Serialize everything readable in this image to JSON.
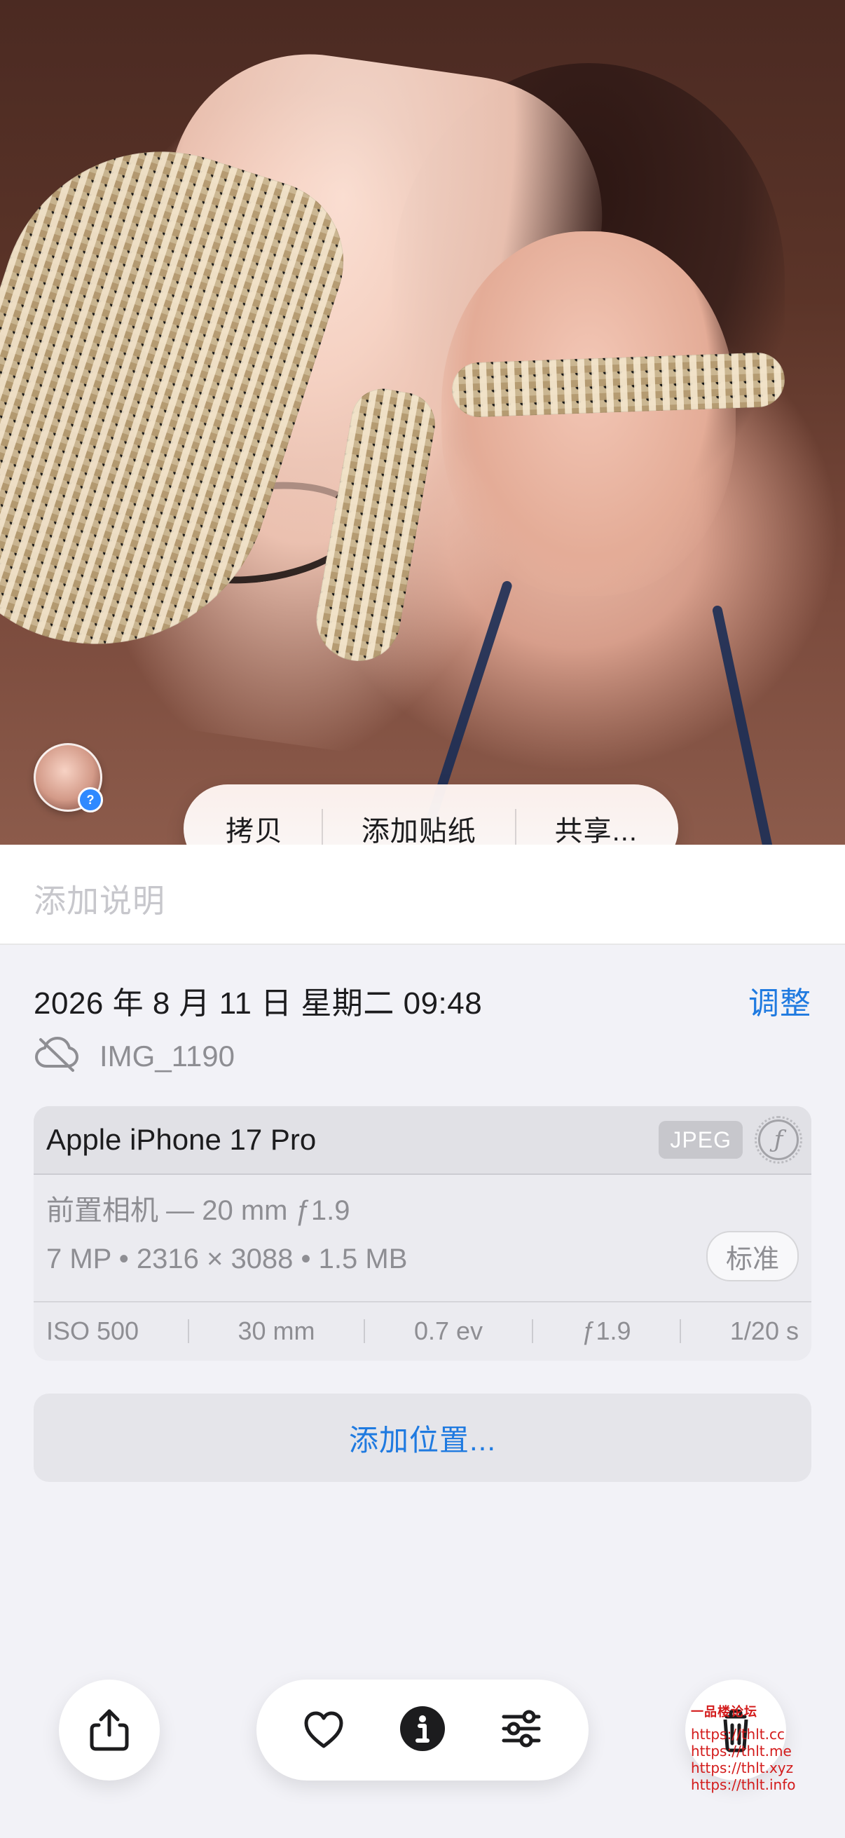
{
  "context_menu": {
    "items": [
      {
        "label": "拷贝"
      },
      {
        "label": "添加贴纸"
      },
      {
        "label": "共享..."
      }
    ]
  },
  "caption": {
    "placeholder": "添加说明"
  },
  "info": {
    "datetime": "2026 年 8 月 11 日 星期二 09:48",
    "adjust_label": "调整",
    "filename": "IMG_1190"
  },
  "camera_card": {
    "device": "Apple iPhone 17 Pro",
    "format_badge": "JPEG",
    "lens": "前置相机 — 20 mm ƒ1.9",
    "specs": "7 MP • 2316 × 3088 • 1.5 MB",
    "quality": "标准",
    "exif": {
      "iso": "ISO 500",
      "focal": "30 mm",
      "ev": "0.7 ev",
      "aperture": "ƒ1.9",
      "shutter": "1/20 s"
    }
  },
  "location": {
    "add_label": "添加位置..."
  },
  "watermark": {
    "title": "一品楼论坛",
    "lines": [
      "https://thlt.cc",
      "https://thlt.me",
      "https://thlt.xyz",
      "https://thlt.info"
    ]
  },
  "icons": {
    "share": "share-icon",
    "favorite": "heart-icon",
    "info": "info-icon",
    "adjust": "sliders-icon",
    "delete": "trash-icon",
    "icloud_off": "cloud-off-icon",
    "f_mark": "aperture-f-icon",
    "avatar_unknown": "question-badge-icon"
  },
  "colors": {
    "accent_blue": "#1f7ae0",
    "background": "#f2f2f7",
    "watermark_red": "#d31b1b"
  }
}
